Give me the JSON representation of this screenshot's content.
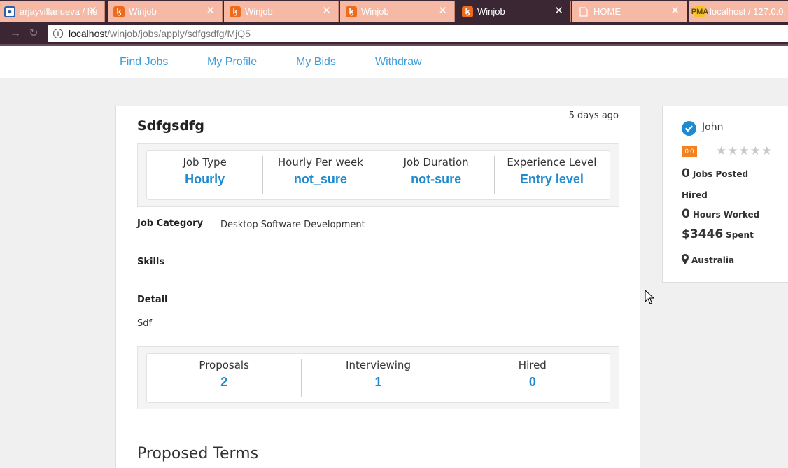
{
  "browser": {
    "tabs": [
      {
        "label": "arjayvillanueva / ho",
        "icon": "github-icon"
      },
      {
        "label": "Winjob",
        "icon": "xampp-icon"
      },
      {
        "label": "Winjob",
        "icon": "xampp-icon"
      },
      {
        "label": "Winjob",
        "icon": "xampp-icon"
      },
      {
        "label": "Winjob",
        "icon": "xampp-icon",
        "active": true
      },
      {
        "label": "HOME",
        "icon": "document-icon"
      },
      {
        "label": "localhost / 127.0.0.",
        "icon": "phpmyadmin-icon"
      }
    ],
    "url": {
      "host": "localhost",
      "path": "/winjob/jobs/apply/sdfgsdfg/MjQ5"
    }
  },
  "nav": {
    "items": [
      "Find Jobs",
      "My Profile",
      "My Bids",
      "Withdraw"
    ]
  },
  "job": {
    "title": "Sdfgsdfg",
    "posted": "5 days ago",
    "summary": [
      {
        "label": "Job Type",
        "value": "Hourly"
      },
      {
        "label": "Hourly Per week",
        "value": "not_sure"
      },
      {
        "label": "Job Duration",
        "value": "not-sure"
      },
      {
        "label": "Experience Level",
        "value": "Entry level"
      }
    ],
    "category_label": "Job Category",
    "category_value": "Desktop Software Development",
    "skills_label": "Skills",
    "detail_label": "Detail",
    "detail_value": "Sdf",
    "activity": [
      {
        "label": "Proposals",
        "value": "2"
      },
      {
        "label": "Interviewing",
        "value": "1"
      },
      {
        "label": "Hired",
        "value": "0"
      }
    ],
    "proposed_terms_title": "Proposed Terms"
  },
  "client": {
    "name": "John",
    "rating": "0.0",
    "stars_filled": 0,
    "stars_total": 5,
    "jobs_posted_num": "0",
    "jobs_posted_label": "Jobs Posted",
    "hired_label": "Hired",
    "hours_num": "0",
    "hours_label": "Hours Worked",
    "spent_num": "$3446",
    "spent_label": "Spent",
    "location": "Australia"
  },
  "colors": {
    "accent": "#1e8bd0",
    "nav_link": "#3d9dd8",
    "tab_bg": "#f5b9a5",
    "chrome": "#3b2633",
    "badge": "#f58220"
  }
}
